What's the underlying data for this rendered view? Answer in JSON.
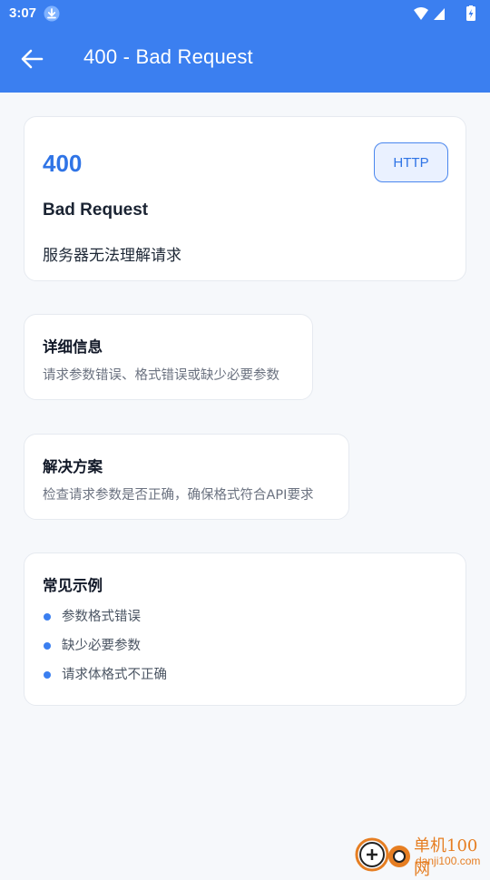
{
  "status_bar": {
    "time": "3:07"
  },
  "app_bar": {
    "title": "400 - Bad Request"
  },
  "summary": {
    "code": "400",
    "badge": "HTTP",
    "name": "Bad Request",
    "description": "服务器无法理解请求"
  },
  "details": {
    "title": "详细信息",
    "text": "请求参数错误、格式错误或缺少必要参数"
  },
  "solution": {
    "title": "解决方案",
    "text": "检查请求参数是否正确，确保格式符合API要求"
  },
  "examples": {
    "title": "常见示例",
    "items": [
      "参数格式错误",
      "缺少必要参数",
      "请求体格式不正确"
    ]
  },
  "watermark": {
    "name": "单机100网",
    "url": "danji100.com"
  },
  "colors": {
    "primary": "#3b7ff0",
    "accent": "#2f74e6",
    "watermark": "#e67e22"
  }
}
